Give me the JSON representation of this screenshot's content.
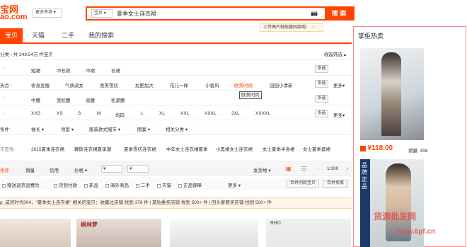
{
  "header": {
    "logo_main": "宝网",
    "logo_sub": "ao.com",
    "market_label": "更多市场",
    "search_type": "宝贝",
    "search_query": "夏季女士连衣裙",
    "search_button": "搜 索",
    "image_search_tip": "上传图片就能搜同款啦!"
  },
  "tabs": [
    {
      "label": "宝贝"
    },
    {
      "label": "天猫"
    },
    {
      "label": "二手"
    },
    {
      "label": "我的搜索"
    }
  ],
  "breadcrumb": {
    "category": "分类",
    "count_text": "共 248.54万 件宝贝",
    "collapse": "收起筛选"
  },
  "filters": {
    "row1": {
      "label": ":",
      "values": [
        "短裙",
        "中长款",
        "中裙",
        "长裙"
      ],
      "multi": "多选"
    },
    "row2": {
      "label": "热点 :",
      "values": [
        "修身显瘦",
        "气质淑女",
        "柔美雪纺",
        "加肥加大",
        "花儿一样",
        "小香风",
        "欧美时尚",
        "田园小清新"
      ],
      "multi": "多选",
      "more": "更多",
      "tooltip": "欧美时尚"
    },
    "row3": {
      "label": ":",
      "values": [
        "中腰",
        "宽松腰",
        "高腰",
        "松紧腰"
      ],
      "multi": "多选"
    },
    "row4": {
      "label": ":",
      "values": [
        "XXS",
        "XS",
        "S",
        "M",
        "均码",
        "L",
        "XL",
        "XXL",
        "XXXL",
        "2XL",
        "XXXXL"
      ],
      "multi": "多选",
      "more": "更多"
    },
    "row5": {
      "label": "条件 :",
      "values": [
        "袖长",
        "领型",
        "服装款式细节",
        "图案",
        "相关分类"
      ]
    },
    "row6": {
      "label": "不是找 :",
      "values": [
        "2015夏季连衣裙",
        "鞭斯连衣裙夏承潮",
        "夏季雪纺连衣裙",
        "中年女士连衣裙夏季",
        "小黑裙女士连衣裙",
        "女士夏季半身裙",
        "女士夏季套裙"
      ]
    }
  },
  "sort_bar": {
    "items": [
      "排序",
      "销量",
      "信用",
      "价格"
    ],
    "price_from": "¥",
    "price_to": "¥",
    "location": "发货地",
    "page": "1/100"
  },
  "filter_bar": {
    "options": [
      "赠送退货运费险",
      "货到付款",
      "新品",
      "海外商品",
      "二手",
      "天猫",
      "正品保障"
    ],
    "more": "更多",
    "merge_same": "合并同款宝贝",
    "merge_seller": "合并卖家"
  },
  "notice": {
    "text": "p_咸贸时代004，\"夏季女士连衣裙\" 相关的宝贝：收藏过店铺 找到 376 件 | 莫钻委买店铺 找到 500+ 件 | 回头客要买店铺 找到 500+ 件"
  },
  "sidebar": {
    "title": "掌柜热卖",
    "price": "¥118.00",
    "sales": "销量: 408",
    "banner_text": "品牌正品",
    "watermark": "货源批发网",
    "watermark_url": "www.6pf.cn"
  },
  "thumbnails": [
    {
      "label": "枫林梦"
    },
    {
      "label": ""
    },
    {
      "label": "BHD"
    }
  ],
  "colors": {
    "accent": "#ff4400",
    "side_border": "#ff8888"
  }
}
